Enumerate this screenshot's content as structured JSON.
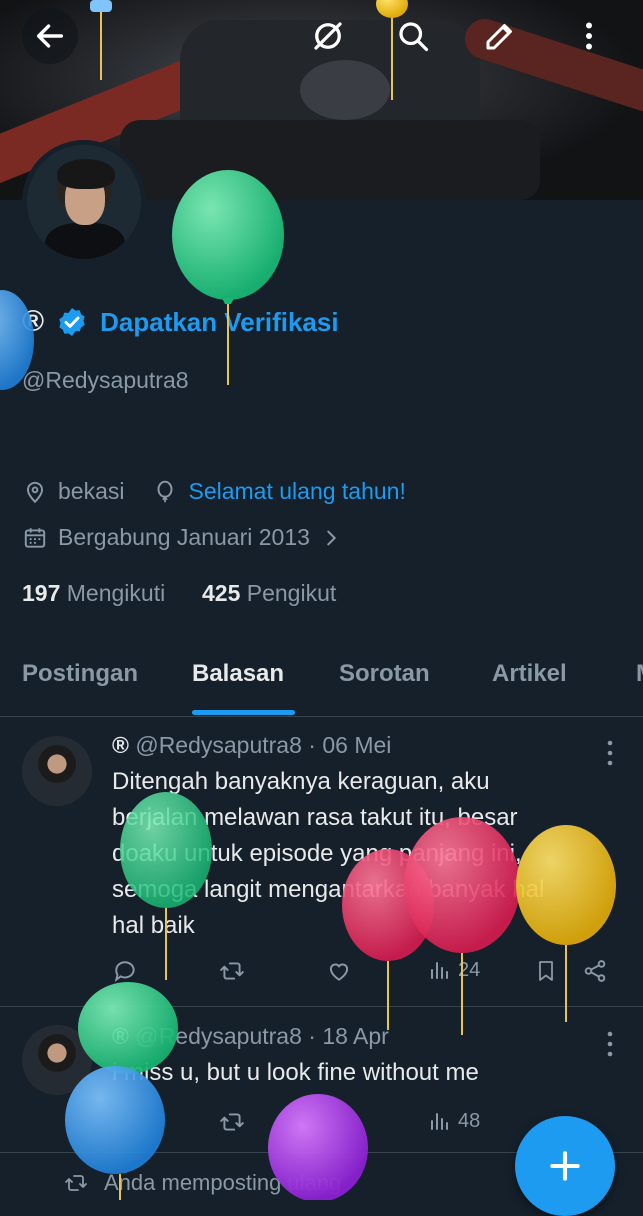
{
  "topbar": {
    "back_icon": "back-arrow-icon",
    "icons": [
      "link-off-icon",
      "search-icon",
      "edit-icon",
      "more-vert-icon"
    ]
  },
  "profile": {
    "display_name": "®",
    "verify_label": "Dapatkan Verifikasi",
    "handle": "@Redysaputra8",
    "location": "bekasi",
    "birthday_text": "Selamat ulang tahun!",
    "joined": "Bergabung Januari 2013",
    "following_count": "197",
    "following_label": "Mengikuti",
    "followers_count": "425",
    "followers_label": "Pengikut"
  },
  "tabs": [
    {
      "label": "Postingan"
    },
    {
      "label": "Balasan"
    },
    {
      "label": "Sorotan"
    },
    {
      "label": "Artikel"
    }
  ],
  "posts": [
    {
      "name": "®",
      "handle": "@Redysaputra8",
      "date": "· 06 Mei",
      "lines": [
        "Ditengah banyaknya keraguan, aku",
        "berjalan melawan rasa takut itu, besar",
        "doaku untuk episode yang panjang ini,",
        "semoga langit mengantarkan banyak hal",
        "hal baik"
      ],
      "views": "24"
    },
    {
      "name": "®",
      "handle": "@Redysaputra8",
      "date": "· 18 Apr",
      "lines": [
        "i miss u, but u look fine without me"
      ],
      "views": "48"
    }
  ],
  "repost_note": "Anda memposting ulang",
  "colors": {
    "background": "#15202b",
    "accent": "#1d9bf0",
    "muted": "#8b98a5",
    "text": "#e7e9ea"
  }
}
